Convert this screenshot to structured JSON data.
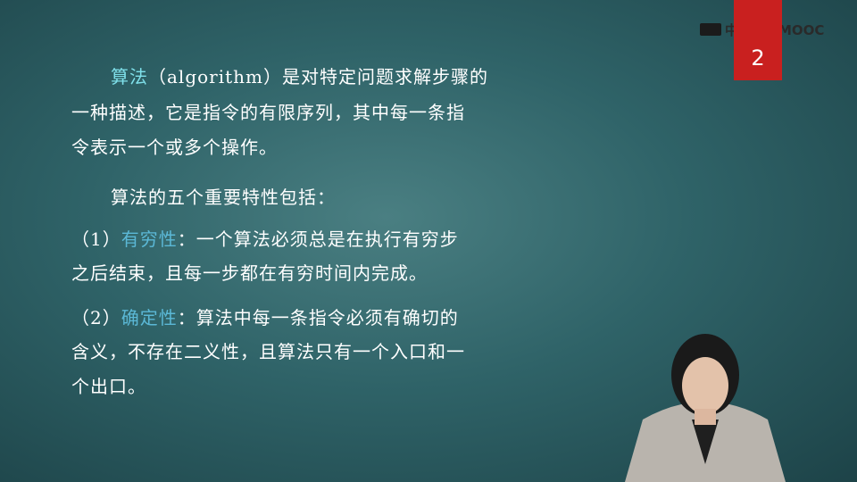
{
  "brand": {
    "logo_text": "中国大学MOOC"
  },
  "slide": {
    "page_number": "2",
    "para1": {
      "term": "算法",
      "paren_term": "（algorithm）",
      "line1_rest": "是对特定问题求解步骤的",
      "line2": "一种描述，它是指令的有限序列，其中每一条指",
      "line3": "令表示一个或多个操作。"
    },
    "para2": {
      "intro": "算法的五个重要特性包括："
    },
    "item1": {
      "num": "（1）",
      "name": "有穷性",
      "colon": "：",
      "line1_rest": "一个算法必须总是在执行有穷步",
      "line2": "之后结束，且每一步都在有穷时间内完成。"
    },
    "item2": {
      "num": "（2）",
      "name": "确定性",
      "colon": "：",
      "line1_rest": "算法中每一条指令必须有确切的",
      "line2": "含义，不存在二义性，且算法只有一个入口和一",
      "line3": "个出口。"
    }
  }
}
